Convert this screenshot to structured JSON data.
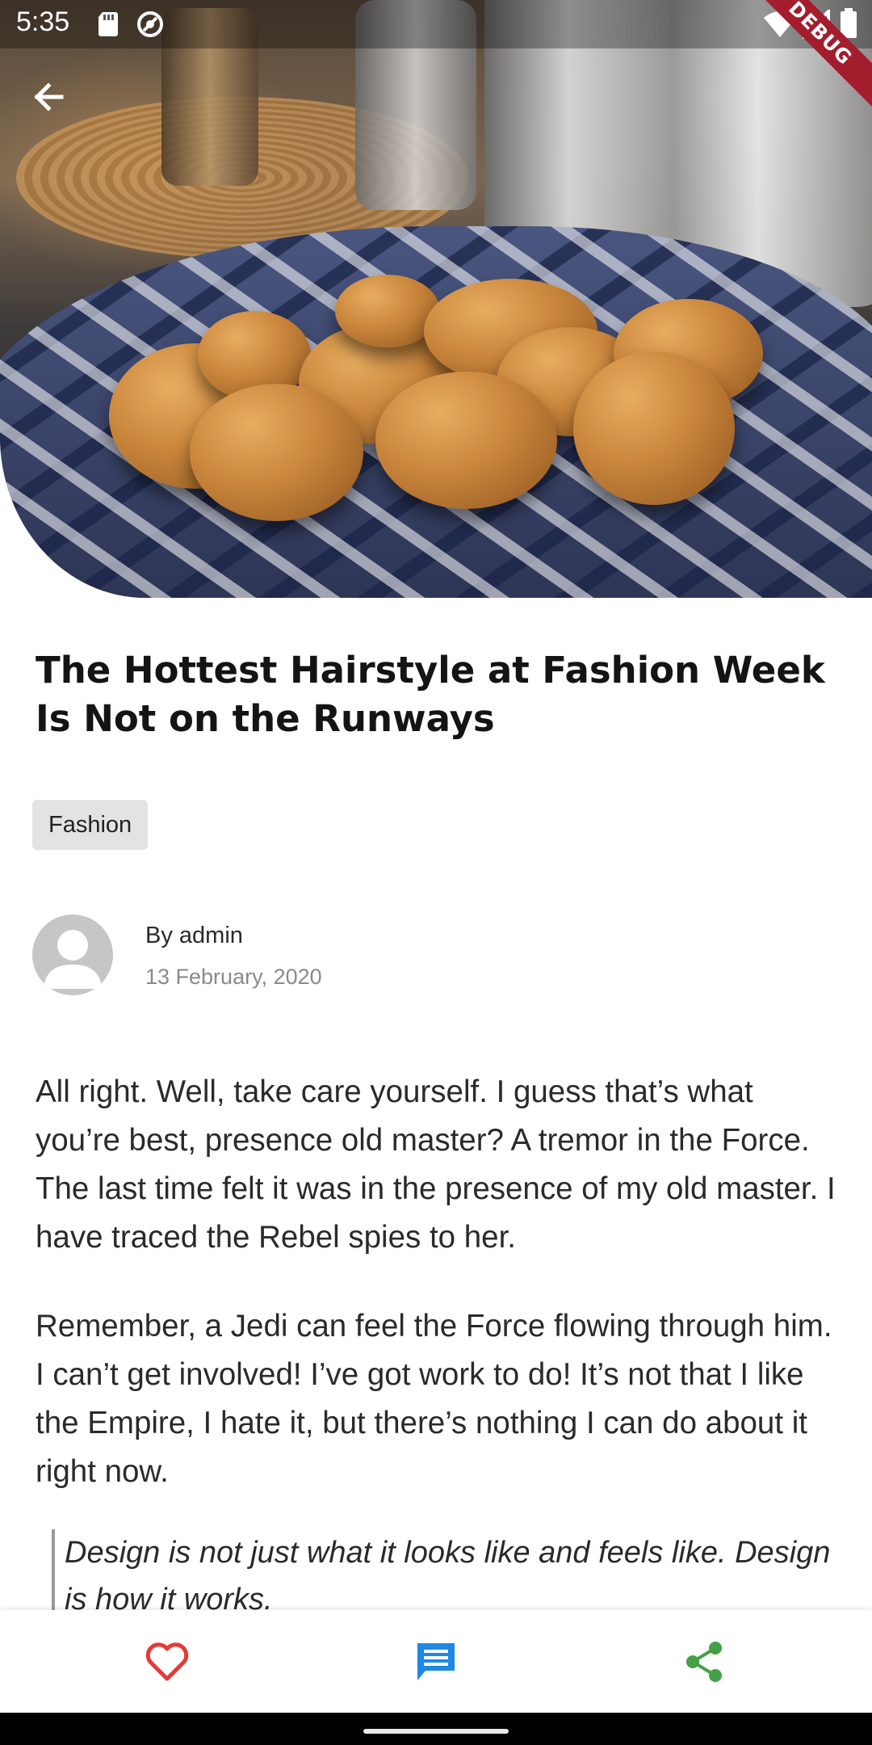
{
  "status_bar": {
    "time": "5:35",
    "debug_label": "DEBUG"
  },
  "hero": {
    "icon": "arrow-left-icon"
  },
  "article": {
    "title": "The Hottest Hairstyle at Fashion Week Is Not on the Runways",
    "category": "Fashion",
    "author": "By admin",
    "date": "13 February, 2020",
    "paragraphs": [
      "All right. Well, take care yourself. I guess that’s what you’re best, presence old master? A tremor in the Force. The last time felt it was in the presence of my old master. I have traced the Rebel spies to her.",
      "Remember, a Jedi can feel the Force flowing through him. I can’t get involved! I’ve got work to do! It’s not that I like the Empire, I hate it, but there’s nothing I can do about it right now."
    ],
    "quote": "Design is not just what it looks like and feels like. Design is how it works."
  },
  "actions": {
    "like_icon": "heart-icon",
    "comment_icon": "comment-icon",
    "share_icon": "share-icon",
    "colors": {
      "like": "#e53935",
      "comment": "#1e88e5",
      "share": "#43a047"
    }
  }
}
